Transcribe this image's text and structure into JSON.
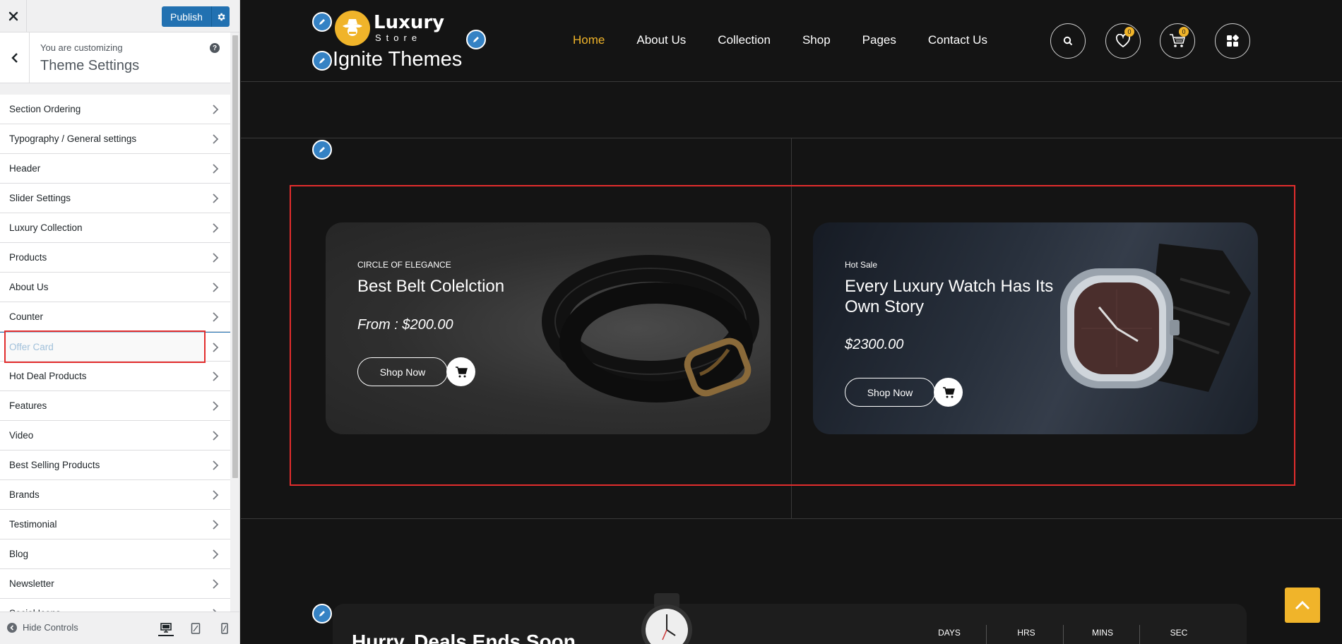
{
  "customizer": {
    "publish_label": "Publish",
    "customizing_label": "You are customizing",
    "title": "Theme Settings",
    "help_glyph": "?",
    "sections": [
      {
        "label": "Section Ordering"
      },
      {
        "label": "Typography / General settings"
      },
      {
        "label": "Header"
      },
      {
        "label": "Slider Settings"
      },
      {
        "label": "Luxury Collection"
      },
      {
        "label": "Products"
      },
      {
        "label": "About Us"
      },
      {
        "label": "Counter"
      },
      {
        "label": "Offer Card",
        "active": true
      },
      {
        "label": "Hot Deal Products"
      },
      {
        "label": "Features"
      },
      {
        "label": "Video"
      },
      {
        "label": "Best Selling Products"
      },
      {
        "label": "Brands"
      },
      {
        "label": "Testimonial"
      },
      {
        "label": "Blog"
      },
      {
        "label": "Newsletter"
      },
      {
        "label": "Social Icons"
      }
    ],
    "hide_controls_label": "Hide Controls",
    "devices": [
      "desktop-icon",
      "tablet-icon",
      "mobile-icon"
    ],
    "accent_color": "#2271b1"
  },
  "site": {
    "logo_word": "Luxury",
    "logo_sub": "Store",
    "site_name": "Ignite Themes",
    "nav": [
      "Home",
      "About Us",
      "Collection",
      "Shop",
      "Pages",
      "Contact Us"
    ],
    "current_nav": "Home",
    "wishlist_count": "0",
    "cart_count": "0",
    "accent_color": "#f0b42a",
    "offer_cards": [
      {
        "subtitle": "CIRCLE OF ELEGANCE",
        "title": "Best Belt Colelction",
        "price": "From : $200.00",
        "button": "Shop Now"
      },
      {
        "subtitle": "Hot Sale",
        "title": "Every Luxury Watch Has Its Own Story",
        "price": "$2300.00",
        "button": "Shop Now"
      }
    ],
    "deal": {
      "title": "Hurry, Deals Ends Soon",
      "countdown_labels": [
        "DAYS",
        "HRS",
        "MINS",
        "SEC"
      ]
    }
  }
}
